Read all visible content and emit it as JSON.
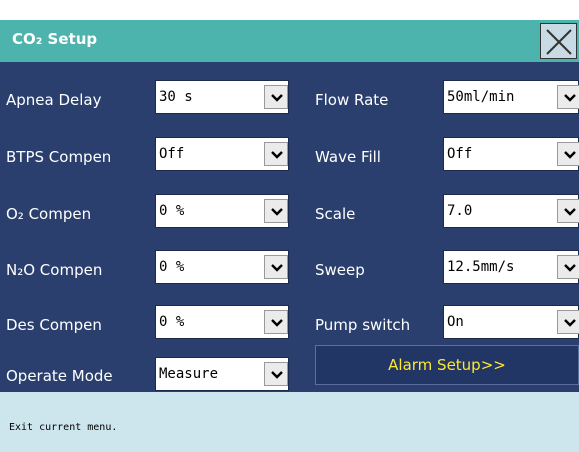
{
  "window": {
    "title": "CO₂ Setup",
    "close_icon": "close-icon"
  },
  "left_column": [
    {
      "label": "Apnea Delay",
      "value": "30 s"
    },
    {
      "label": "BTPS Compen",
      "value": "Off"
    },
    {
      "label": "O₂ Compen",
      "value": "0 %"
    },
    {
      "label": "N₂O Compen",
      "value": "0 %"
    },
    {
      "label": "Des Compen",
      "value": "0 %"
    },
    {
      "label": "Operate Mode",
      "value": "Measure"
    }
  ],
  "right_column": [
    {
      "label": "Flow Rate",
      "value": "50ml/min"
    },
    {
      "label": "Wave Fill",
      "value": "Off"
    },
    {
      "label": "Scale",
      "value": "7.0"
    },
    {
      "label": "Sweep",
      "value": "12.5mm/s"
    },
    {
      "label": "Pump switch",
      "value": "On"
    }
  ],
  "alarm_button": {
    "label": "Alarm Setup>>"
  },
  "status": {
    "text": "Exit current menu."
  },
  "colors": {
    "title_bar": "#4db3ad",
    "panel": "#2a3f6e",
    "status_bar": "#cde6ee",
    "alarm_text": "#ffe830"
  }
}
